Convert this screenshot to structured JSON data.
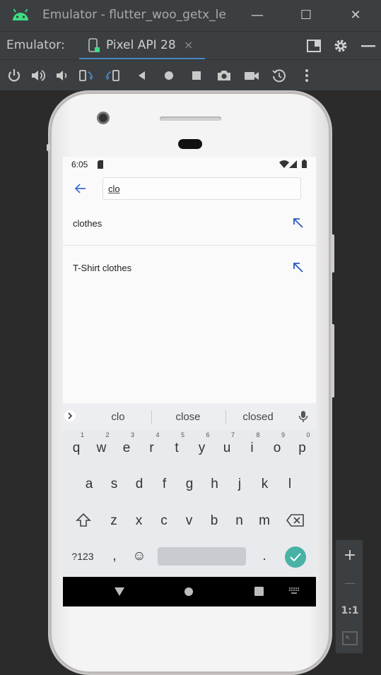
{
  "window": {
    "title": "Emulator - flutter_woo_getx_le",
    "minimize_glyph": "—",
    "maximize_glyph": "☐",
    "close_glyph": "✕",
    "app_icon": "android-icon"
  },
  "tabs": {
    "label": "Emulator:",
    "active_tab": "Pixel API 28",
    "close_glyph": "×",
    "accent": "#4a88c7"
  },
  "toolbar": {
    "icons": [
      "power-icon",
      "volume-up-icon",
      "volume-down-icon",
      "rotate-left-icon",
      "rotate-right-icon",
      "back-icon",
      "home-icon",
      "overview-icon",
      "camera-icon",
      "screen-record-icon",
      "snapshot-icon",
      "more-icon"
    ]
  },
  "device": {
    "status_time": "6:05",
    "search": {
      "query": "clo"
    },
    "results": [
      {
        "label": "clothes"
      },
      {
        "label": "T-Shirt clothes"
      }
    ],
    "keyboard": {
      "suggestions": [
        "clo",
        "close",
        "closed"
      ],
      "row1": [
        {
          "k": "q",
          "h": "1"
        },
        {
          "k": "w",
          "h": "2"
        },
        {
          "k": "e",
          "h": "3"
        },
        {
          "k": "r",
          "h": "4"
        },
        {
          "k": "t",
          "h": "5"
        },
        {
          "k": "y",
          "h": "6"
        },
        {
          "k": "u",
          "h": "7"
        },
        {
          "k": "i",
          "h": "8"
        },
        {
          "k": "o",
          "h": "9"
        },
        {
          "k": "p",
          "h": "0"
        }
      ],
      "row2": [
        "a",
        "s",
        "d",
        "f",
        "g",
        "h",
        "j",
        "k",
        "l"
      ],
      "row3": [
        "z",
        "x",
        "c",
        "v",
        "b",
        "n",
        "m"
      ],
      "symbols_key": "?123",
      "comma_key": ",",
      "period_key": ".",
      "emoji_glyph": "☺",
      "enter_color": "#48b2a4"
    }
  },
  "zoom_panel": {
    "zoom_in": "+",
    "zoom_out": "—",
    "actual_size": "1:1"
  }
}
